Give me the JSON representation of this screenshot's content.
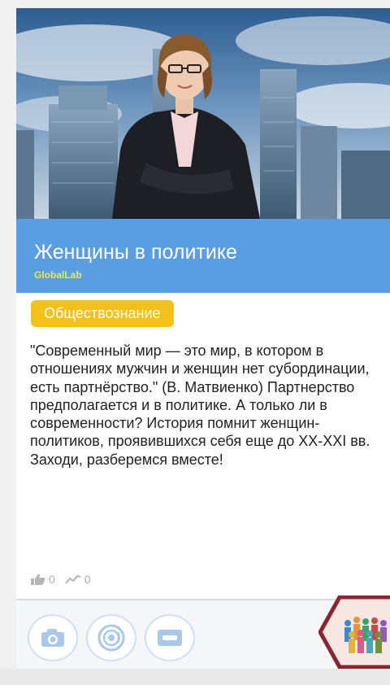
{
  "project": {
    "title": "Женщины в политике",
    "organization": "GlobalLab",
    "subject_tag": "Обществознание",
    "description": "\"Современный мир — это мир, в котором в отношениях мужчин и женщин нет субординации, есть партнёрство.\" (В. Матвиенко) Партнерство предполагается и в политике. А только ли в современности? История помнит женщин-политиков, проявившихся себя еще до XX-XXI вв. Заходи, разберемся вместе!"
  },
  "stats": {
    "likes": "0",
    "activity": "0"
  },
  "footer": {
    "icons": [
      "camera-icon",
      "sensor-icon",
      "card-icon"
    ],
    "badge": "people-badge-icon"
  },
  "colors": {
    "title_bar": "#5a9de0",
    "org": "#ecef3a",
    "tag": "#f4c01a",
    "icon_stroke": "#a9c8ea",
    "badge_border": "#8a2430"
  }
}
